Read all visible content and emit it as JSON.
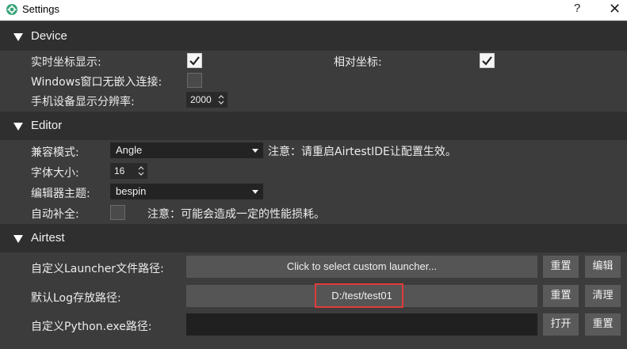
{
  "window": {
    "title": "Settings",
    "help_glyph": "?",
    "close_glyph": "✕"
  },
  "device": {
    "header": "Device",
    "realtime_coord_label": "实时坐标显示:",
    "realtime_coord_checked": true,
    "relative_coord_label": "相对坐标:",
    "relative_coord_checked": true,
    "windows_embed_label": "Windows窗口无嵌入连接:",
    "windows_embed_checked": false,
    "resolution_label": "手机设备显示分辨率:",
    "resolution_value": "2000"
  },
  "editor": {
    "header": "Editor",
    "compat_label": "兼容模式:",
    "compat_value": "Angle",
    "compat_note": "注意：请重启AirtestIDE让配置生效。",
    "font_size_label": "字体大小:",
    "font_size_value": "16",
    "theme_label": "编辑器主题:",
    "theme_value": "bespin",
    "autocomplete_label": "自动补全:",
    "autocomplete_checked": false,
    "autocomplete_note": "注意：可能会造成一定的性能损耗。"
  },
  "airtest": {
    "header": "Airtest",
    "launcher_label": "自定义Launcher文件路径:",
    "launcher_value": "Click to select custom launcher...",
    "launcher_reset": "重置",
    "launcher_edit": "编辑",
    "log_label": "默认Log存放路径:",
    "log_value": "D:/test/test01",
    "log_reset": "重置",
    "log_clear": "清理",
    "python_label": "自定义Python.exe路径:",
    "python_value": "",
    "python_open": "打开",
    "python_reset": "重置"
  },
  "colors": {
    "highlight": "#e23a3a",
    "section_bg": "#2f2f2f",
    "panel_bg": "#3c3c3c"
  }
}
